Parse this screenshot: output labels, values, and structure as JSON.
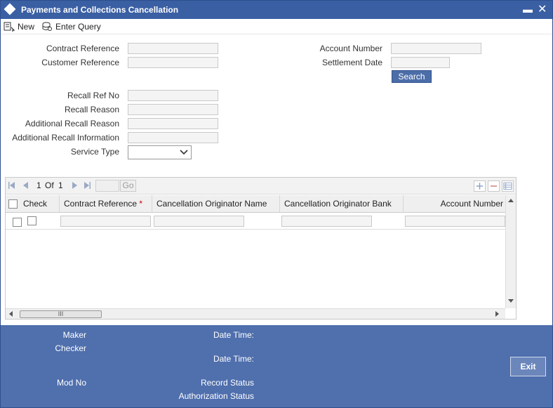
{
  "window": {
    "title": "Payments and Collections Cancellation",
    "minimize": "▬",
    "close": "✕"
  },
  "toolbar": {
    "new_label": "New",
    "enter_query_label": "Enter Query"
  },
  "form": {
    "contract_reference": {
      "label": "Contract Reference",
      "value": ""
    },
    "customer_reference": {
      "label": "Customer Reference",
      "value": ""
    },
    "account_number": {
      "label": "Account Number",
      "value": ""
    },
    "settlement_date": {
      "label": "Settlement Date",
      "value": ""
    },
    "search_label": "Search",
    "recall_ref_no": {
      "label": "Recall Ref No",
      "value": ""
    },
    "recall_reason": {
      "label": "Recall Reason",
      "value": ""
    },
    "additional_recall_reason": {
      "label": "Additional Recall Reason",
      "value": ""
    },
    "additional_recall_information": {
      "label": "Additional Recall Information",
      "value": ""
    },
    "service_type": {
      "label": "Service Type",
      "selected": ""
    }
  },
  "grid": {
    "pager": {
      "current": "1",
      "of_label": "Of",
      "total": "1",
      "go_label": "Go"
    },
    "columns": [
      "Check",
      "Contract Reference",
      "Cancellation Originator Name",
      "Cancellation Originator Bank",
      "Account Number"
    ],
    "required_marker": "*",
    "scroll_thumb": "III"
  },
  "footer": {
    "maker": "Maker",
    "checker": "Checker",
    "date_time_1": "Date Time:",
    "date_time_2": "Date Time:",
    "mod_no": "Mod No",
    "record_status": "Record Status",
    "authorization_status": "Authorization Status",
    "exit_label": "Exit"
  },
  "colors": {
    "title_bar": "#3a5fa3",
    "footer": "#4f6fad",
    "search_button": "#4c6ea8",
    "required": "#cc0000"
  }
}
